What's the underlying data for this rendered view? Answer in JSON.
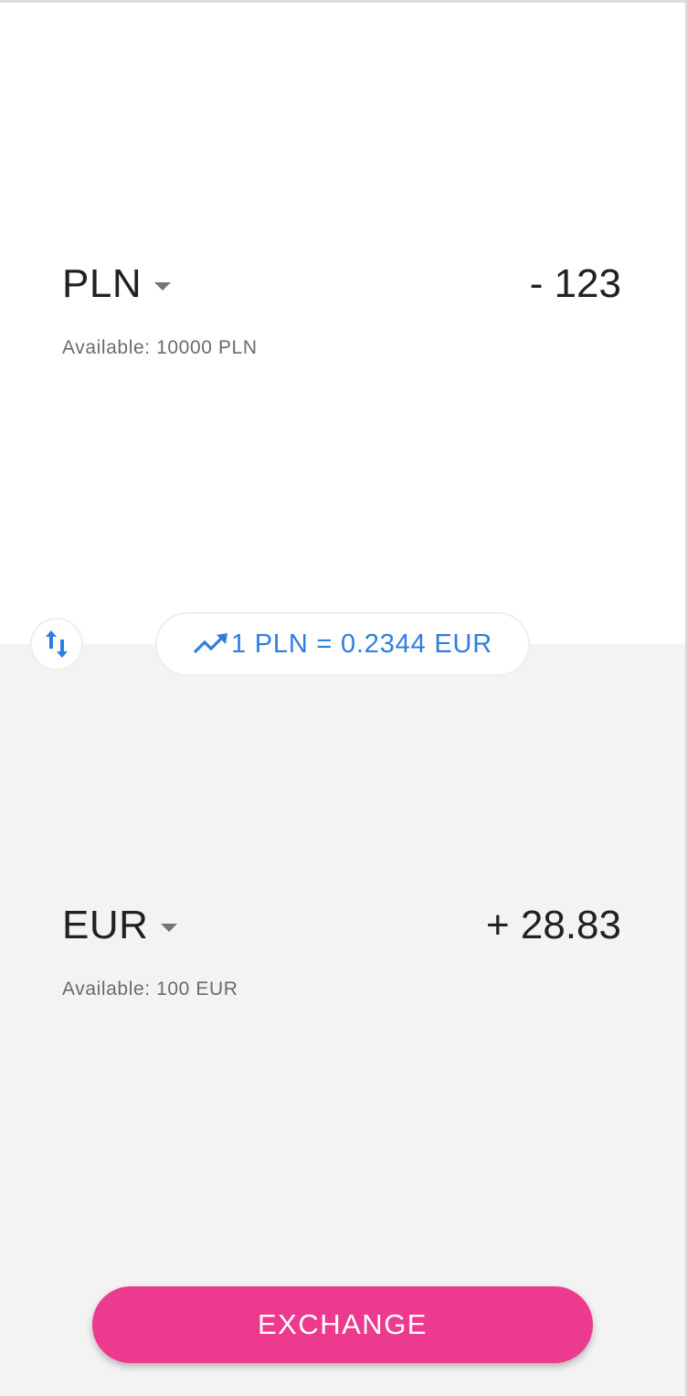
{
  "from": {
    "currency": "PLN",
    "amount": "- 123",
    "available": "Available: 10000 PLN"
  },
  "to": {
    "currency": "EUR",
    "amount": "+ 28.83",
    "available": "Available: 100 EUR"
  },
  "rate": {
    "icon": "trending-up-icon",
    "text": "1 PLN = 0.2344 EUR"
  },
  "swap": {
    "icon": "swap-vertical-icon"
  },
  "exchange_button": {
    "label": "EXCHANGE"
  },
  "colors": {
    "accent": "#2f7de1",
    "primary_button": "#ec3a8f",
    "bottom_panel_bg": "#f3f3f3",
    "text_dark": "#212121",
    "text_muted": "#6b6b6b"
  }
}
